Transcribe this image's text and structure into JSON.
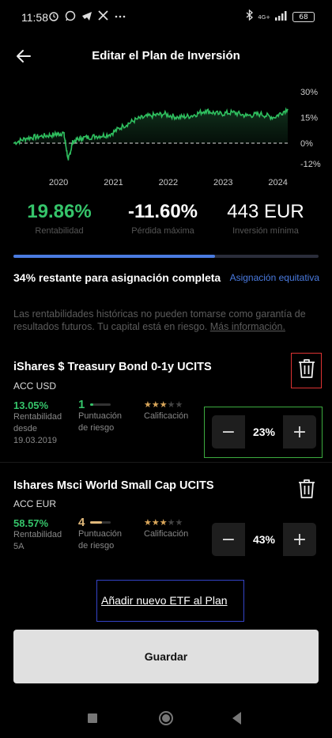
{
  "status": {
    "time": "11:58",
    "network": "4G+",
    "battery": "68",
    "left_icons": [
      "alarm-icon",
      "whatsapp-icon",
      "telegram-icon",
      "x-icon",
      "more-icon"
    ],
    "right_icons": [
      "bluetooth-icon",
      "signal-icon",
      "battery-icon"
    ]
  },
  "header": {
    "title": "Editar el Plan de Inversión",
    "back_icon": "arrow-left-icon"
  },
  "chart_data": {
    "type": "line",
    "x_ticks": [
      "2020",
      "2021",
      "2022",
      "2023",
      "2024"
    ],
    "y_ticks": [
      "30%",
      "15%",
      "0%",
      "-12%"
    ],
    "ylim": [
      -12,
      30
    ],
    "x": [
      "2019-03",
      "2019-06",
      "2019-09",
      "2019-12",
      "2020-02",
      "2020-03",
      "2020-04",
      "2020-06",
      "2020-09",
      "2020-12",
      "2021-03",
      "2021-06",
      "2021-09",
      "2021-12",
      "2022-03",
      "2022-06",
      "2022-09",
      "2022-12",
      "2023-03",
      "2023-06",
      "2023-09",
      "2023-12",
      "2024-03"
    ],
    "series": [
      {
        "values": [
          0,
          3,
          4,
          5,
          6,
          -10,
          1,
          3,
          4,
          5,
          10,
          14,
          16,
          17,
          15,
          16,
          19,
          17,
          18,
          16,
          17,
          15,
          20
        ]
      }
    ],
    "baseline": 0,
    "line_color": "#2fbf5f",
    "grid": false
  },
  "metrics": [
    {
      "value": "19.86%",
      "label": "Rentabilidad"
    },
    {
      "value": "-11.60%",
      "label": "Pérdida máxima"
    },
    {
      "value": "443 EUR",
      "label": "Inversión mínima"
    }
  ],
  "allocation": {
    "progress": 0.66,
    "remaining_text": "34% restante para asignación completa",
    "equal_link": "Asignación equitativa"
  },
  "disclaimer": {
    "text": "Las rentabilidades históricas no pueden tomarse como garantía de resultados futuros. Tu capital está en riesgo.",
    "more_link": "Más información."
  },
  "funds": [
    {
      "name": "iShares $ Treasury Bond 0-1y UCITS",
      "sub": "ACC USD",
      "return_value": "13.05%",
      "return_label_1": "Rentabilidad",
      "return_label_2": "desde",
      "return_label_3": "19.03.2019",
      "risk_value": "1",
      "risk_level": 0.14,
      "risk_color": "#35c46a",
      "risk_label_1": "Puntuación",
      "risk_label_2": "de riesgo",
      "rating_label": "Calificación",
      "rating": 3,
      "allocation": "23%"
    },
    {
      "name": "Ishares Msci World Small Cap UCITS",
      "sub": "ACC EUR",
      "return_value": "58.57%",
      "return_label_1": "Rentabilidad",
      "return_label_2": "5A",
      "risk_value": "4",
      "risk_level": 0.57,
      "risk_color": "#e0b87a",
      "risk_label_1": "Puntuación",
      "risk_label_2": "de riesgo",
      "rating_label": "Calificación",
      "rating": 3,
      "allocation": "43%"
    }
  ],
  "stepper": {
    "minus": "−",
    "plus": "+"
  },
  "add_etf": "Añadir nuevo ETF al Plan",
  "save": "Guardar"
}
